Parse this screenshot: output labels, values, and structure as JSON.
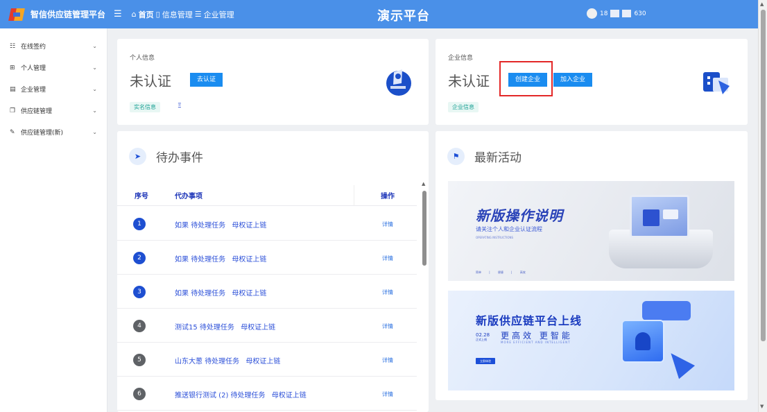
{
  "header": {
    "app_name": "智信供应链管理平台",
    "collapse_icon": "☰",
    "breadcrumbs": [
      "首页",
      "信息管理",
      "企业管理"
    ],
    "platform_title": "演示平台",
    "user_phone_prefix": "18",
    "user_phone_suffix": "630"
  },
  "sidebar": {
    "items": [
      {
        "label": "在线签约",
        "icon": "contract-icon"
      },
      {
        "label": "个人管理",
        "icon": "grid-icon"
      },
      {
        "label": "企业管理",
        "icon": "company-icon"
      },
      {
        "label": "供应链管理",
        "icon": "file-icon"
      },
      {
        "label": "供应链管理(新)",
        "icon": "edit-icon"
      }
    ]
  },
  "personal": {
    "label": "个人信息",
    "status": "未认证",
    "verify_button": "去认证",
    "tag": "实名信息",
    "masked_name": "Ξ"
  },
  "company": {
    "label": "企业信息",
    "status": "未认证",
    "create_button": "创建企业",
    "join_button": "加入企业",
    "tag": "企业信息"
  },
  "todo": {
    "title": "待办事件",
    "columns": {
      "index": "序号",
      "item": "代办事项",
      "action": "操作"
    },
    "rows": [
      {
        "num": "1",
        "name": "如果",
        "status": "待处理任务",
        "type": "母权证上链",
        "action": "详情",
        "style": "blue"
      },
      {
        "num": "2",
        "name": "如果",
        "status": "待处理任务",
        "type": "母权证上链",
        "action": "详情",
        "style": "blue"
      },
      {
        "num": "3",
        "name": "如果",
        "status": "待处理任务",
        "type": "母权证上链",
        "action": "详情",
        "style": "blue"
      },
      {
        "num": "4",
        "name": "测试15",
        "status": "待处理任务",
        "type": "母权证上链",
        "action": "详情",
        "style": "gray"
      },
      {
        "num": "5",
        "name": "山东大葱",
        "status": "待处理任务",
        "type": "母权证上链",
        "action": "详情",
        "style": "gray"
      },
      {
        "num": "6",
        "name": "推送银行测试 (2)",
        "status": "待处理任务",
        "type": "母权证上链",
        "action": "详情",
        "style": "gray"
      }
    ]
  },
  "activity": {
    "title": "最新活动",
    "banner1": {
      "title": "新版操作说明",
      "subtitle": "请关注个人和企业认证流程",
      "en": "OPERATING INSTRUCTIONS",
      "footer": "简单 | 便捷 | 高效"
    },
    "banner2": {
      "title_prefix": "新版",
      "title_main": "供应链平台上线",
      "date": "02.28",
      "date_sub": "正式上线",
      "slogan": "更高效 更智能",
      "en": "MORE EFFICIENT AND INTELLIGENT",
      "button": "立即体验"
    }
  }
}
